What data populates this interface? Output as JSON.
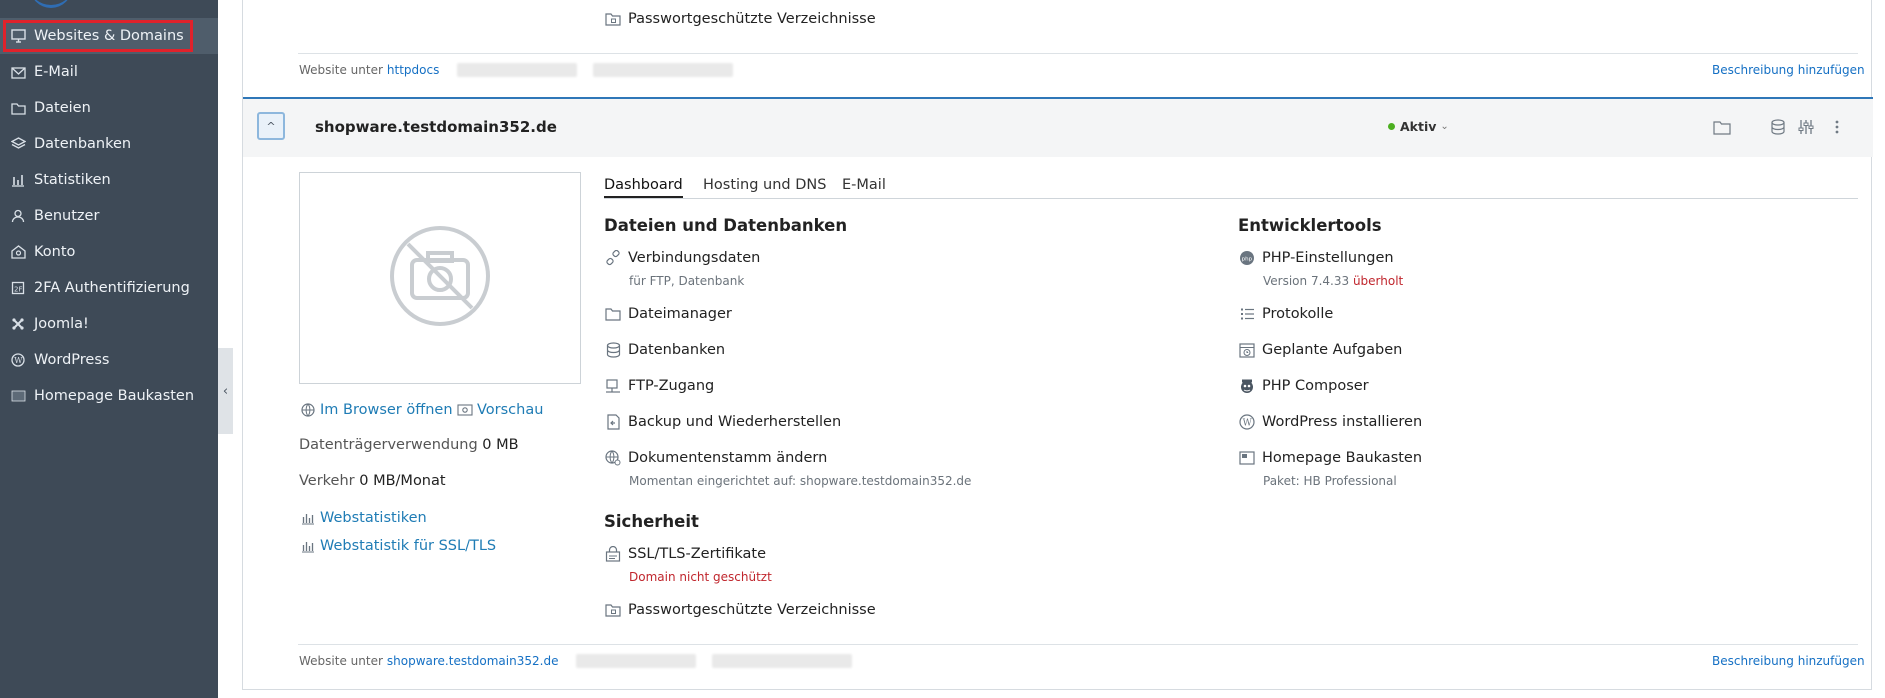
{
  "sidebar": {
    "items": [
      {
        "label": "Websites & Domains",
        "icon": "monitor-icon"
      },
      {
        "label": "E-Mail",
        "icon": "mail-icon"
      },
      {
        "label": "Dateien",
        "icon": "folder-icon"
      },
      {
        "label": "Datenbanken",
        "icon": "layers-icon"
      },
      {
        "label": "Statistiken",
        "icon": "bar-chart-icon"
      },
      {
        "label": "Benutzer",
        "icon": "user-icon"
      },
      {
        "label": "Konto",
        "icon": "account-icon"
      },
      {
        "label": "2FA Authentifizierung",
        "icon": "two-fa-icon"
      },
      {
        "label": "Joomla!",
        "icon": "joomla-icon"
      },
      {
        "label": "WordPress",
        "icon": "wordpress-icon"
      },
      {
        "label": "Homepage Baukasten",
        "icon": "builder-icon"
      }
    ],
    "highlight_color": "#e0222b"
  },
  "top_section": {
    "item": "Passwortgeschützte Verzeichnisse",
    "footer_prefix": "Website unter",
    "footer_link": "httpdocs",
    "footer_action": "Beschreibung hinzufügen"
  },
  "domain": {
    "name": "shopware.testdomain352.de",
    "status": "Aktiv",
    "status_color": "#4caf20",
    "accent_color": "#2f77b8"
  },
  "left_panel": {
    "open_browser": "Im Browser öffnen",
    "preview": "Vorschau",
    "disk_label": "Datenträgerverwendung",
    "disk_value": "0 MB",
    "traffic_label": "Verkehr",
    "traffic_value": "0 MB/Monat",
    "webstats": "Webstatistiken",
    "webstats_ssl": "Webstatistik für SSL/TLS"
  },
  "tabs": [
    "Dashboard",
    "Hosting und DNS",
    "E-Mail"
  ],
  "files_section": {
    "title": "Dateien und Datenbanken",
    "items": [
      {
        "label": "Verbindungsdaten",
        "sub": "für FTP, Datenbank"
      },
      {
        "label": "Dateimanager"
      },
      {
        "label": "Datenbanken"
      },
      {
        "label": "FTP-Zugang"
      },
      {
        "label": "Backup und Wiederherstellen"
      },
      {
        "label": "Dokumentenstamm ändern",
        "sub": "Momentan eingerichtet auf: shopware.testdomain352.de"
      }
    ]
  },
  "security_section": {
    "title": "Sicherheit",
    "items": [
      {
        "label": "SSL/TLS-Zertifikate",
        "sub": "Domain nicht geschützt"
      },
      {
        "label": "Passwortgeschützte Verzeichnisse"
      }
    ]
  },
  "dev_section": {
    "title": "Entwicklertools",
    "items": [
      {
        "label": "PHP-Einstellungen",
        "sub_prefix": "Version 7.4.33",
        "sub_warn": "überholt"
      },
      {
        "label": "Protokolle"
      },
      {
        "label": "Geplante Aufgaben"
      },
      {
        "label": "PHP Composer"
      },
      {
        "label": "WordPress installieren"
      },
      {
        "label": "Homepage Baukasten",
        "sub": "Paket: HB Professional"
      }
    ]
  },
  "bottom_footer": {
    "prefix": "Website unter",
    "link": "shopware.testdomain352.de",
    "action": "Beschreibung hinzufügen"
  }
}
